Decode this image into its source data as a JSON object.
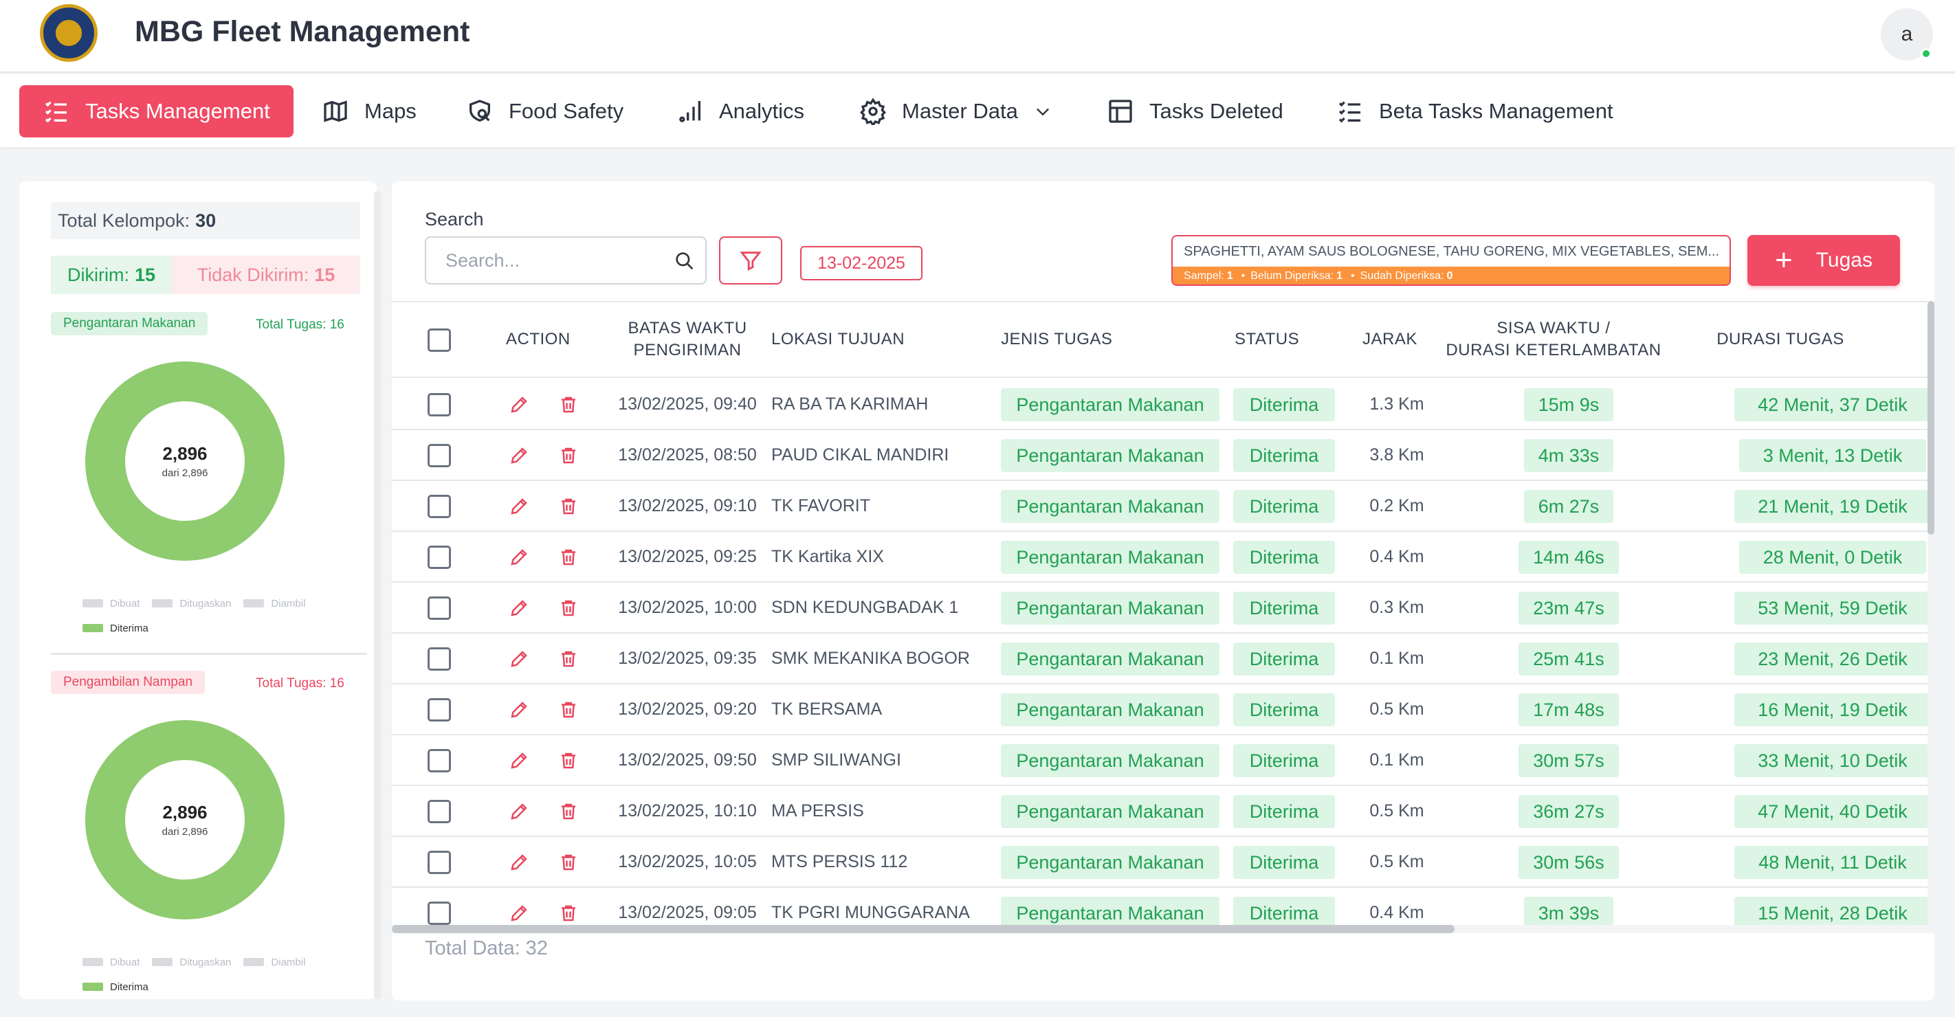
{
  "app": {
    "title": "MBG Fleet Management",
    "avatar_letter": "a"
  },
  "nav": [
    {
      "label": "Tasks Management",
      "icon": "list-check-icon",
      "active": true
    },
    {
      "label": "Maps",
      "icon": "map-icon"
    },
    {
      "label": "Food Safety",
      "icon": "search-shield-icon"
    },
    {
      "label": "Analytics",
      "icon": "bar-chart-icon"
    },
    {
      "label": "Master Data",
      "icon": "gear-icon",
      "dropdown": true
    },
    {
      "label": "Tasks Deleted",
      "icon": "table-icon"
    },
    {
      "label": "Beta Tasks Management",
      "icon": "list-check-icon"
    }
  ],
  "summary": {
    "total_kelompok_label": "Total Kelompok:",
    "total_kelompok_value": "30",
    "dikirim_label": "Dikirim:",
    "dikirim_value": "15",
    "tidak_dikirim_label": "Tidak Dikirim:",
    "tidak_dikirim_value": "15"
  },
  "charts": [
    {
      "badge": "Pengantaran Makanan",
      "total_tugas": "Total Tugas: 16",
      "center_value": "2,896",
      "center_sub": "dari 2,896",
      "legend": [
        "Dibuat",
        "Ditugaskan",
        "Diambil",
        "Diterima"
      ]
    },
    {
      "badge": "Pengambilan Nampan",
      "total_tugas": "Total Tugas: 16",
      "center_value": "2,896",
      "center_sub": "dari 2,896",
      "legend": [
        "Dibuat",
        "Ditugaskan",
        "Diambil",
        "Diterima"
      ]
    }
  ],
  "chart_data": [
    {
      "type": "pie",
      "title": "Pengantaran Makanan",
      "categories": [
        "Dibuat",
        "Ditugaskan",
        "Diambil",
        "Diterima"
      ],
      "values": [
        0,
        0,
        0,
        2896
      ]
    },
    {
      "type": "pie",
      "title": "Pengambilan Nampan",
      "categories": [
        "Dibuat",
        "Ditugaskan",
        "Diambil",
        "Diterima"
      ],
      "values": [
        0,
        0,
        0,
        2896
      ]
    }
  ],
  "colors": {
    "accent": "#f04a64",
    "success": "#22a054",
    "donut": "#8fcb6f",
    "menu_orange": "#fb923c"
  },
  "toolbar": {
    "search_label": "Search",
    "search_placeholder": "Search...",
    "date": "13-02-2025",
    "menu_text": "SPAGHETTI, AYAM SAUS BOLOGNESE, TAHU GORENG, MIX VEGETABLES, SEM...",
    "menu_sampel_label": "Sampel:",
    "menu_sampel_value": "1",
    "menu_belum_label": "Belum Diperiksa:",
    "menu_belum_value": "1",
    "menu_sudah_label": "Sudah Diperiksa:",
    "menu_sudah_value": "0",
    "add_button": "Tugas"
  },
  "table": {
    "headers": {
      "action": "ACTION",
      "batas_1": "BATAS WAKTU",
      "batas_2": "PENGIRIMAN",
      "lokasi": "LOKASI TUJUAN",
      "jenis": "JENIS TUGAS",
      "status": "STATUS",
      "jarak": "JARAK",
      "sisa_1": "SISA WAKTU /",
      "sisa_2": "DURASI KETERLAMBATAN",
      "durasi": "DURASI TUGAS"
    },
    "rows": [
      {
        "batas": "13/02/2025, 09:40",
        "lokasi": "RA BA TA KARIMAH",
        "jenis": "Pengantaran Makanan",
        "status": "Diterima",
        "jarak": "1.3 Km",
        "sisa": "15m 9s",
        "durasi": "42 Menit, 37 Detik"
      },
      {
        "batas": "13/02/2025, 08:50",
        "lokasi": "PAUD CIKAL MANDIRI",
        "jenis": "Pengantaran Makanan",
        "status": "Diterima",
        "jarak": "3.8 Km",
        "sisa": "4m 33s",
        "durasi": "3 Menit, 13 Detik"
      },
      {
        "batas": "13/02/2025, 09:10",
        "lokasi": "TK FAVORIT",
        "jenis": "Pengantaran Makanan",
        "status": "Diterima",
        "jarak": "0.2 Km",
        "sisa": "6m 27s",
        "durasi": "21 Menit, 19 Detik"
      },
      {
        "batas": "13/02/2025, 09:25",
        "lokasi": "TK Kartika XIX",
        "jenis": "Pengantaran Makanan",
        "status": "Diterima",
        "jarak": "0.4 Km",
        "sisa": "14m 46s",
        "durasi": "28 Menit, 0 Detik"
      },
      {
        "batas": "13/02/2025, 10:00",
        "lokasi": "SDN KEDUNGBADAK 1",
        "jenis": "Pengantaran Makanan",
        "status": "Diterima",
        "jarak": "0.3 Km",
        "sisa": "23m 47s",
        "durasi": "53 Menit, 59 Detik"
      },
      {
        "batas": "13/02/2025, 09:35",
        "lokasi": "SMK MEKANIKA BOGOR",
        "jenis": "Pengantaran Makanan",
        "status": "Diterima",
        "jarak": "0.1 Km",
        "sisa": "25m 41s",
        "durasi": "23 Menit, 26 Detik"
      },
      {
        "batas": "13/02/2025, 09:20",
        "lokasi": "TK BERSAMA",
        "jenis": "Pengantaran Makanan",
        "status": "Diterima",
        "jarak": "0.5 Km",
        "sisa": "17m 48s",
        "durasi": "16 Menit, 19 Detik"
      },
      {
        "batas": "13/02/2025, 09:50",
        "lokasi": "SMP SILIWANGI",
        "jenis": "Pengantaran Makanan",
        "status": "Diterima",
        "jarak": "0.1 Km",
        "sisa": "30m 57s",
        "durasi": "33 Menit, 10 Detik"
      },
      {
        "batas": "13/02/2025, 10:10",
        "lokasi": "MA PERSIS",
        "jenis": "Pengantaran Makanan",
        "status": "Diterima",
        "jarak": "0.5 Km",
        "sisa": "36m 27s",
        "durasi": "47 Menit, 40 Detik"
      },
      {
        "batas": "13/02/2025, 10:05",
        "lokasi": "MTS PERSIS 112",
        "jenis": "Pengantaran Makanan",
        "status": "Diterima",
        "jarak": "0.5 Km",
        "sisa": "30m 56s",
        "durasi": "48 Menit, 11 Detik"
      },
      {
        "batas": "13/02/2025, 09:05",
        "lokasi": "TK PGRI MUNGGARANA",
        "jenis": "Pengantaran Makanan",
        "status": "Diterima",
        "jarak": "0.4 Km",
        "sisa": "3m 39s",
        "durasi": "15 Menit, 28 Detik"
      }
    ],
    "total_data": "Total Data: 32"
  }
}
